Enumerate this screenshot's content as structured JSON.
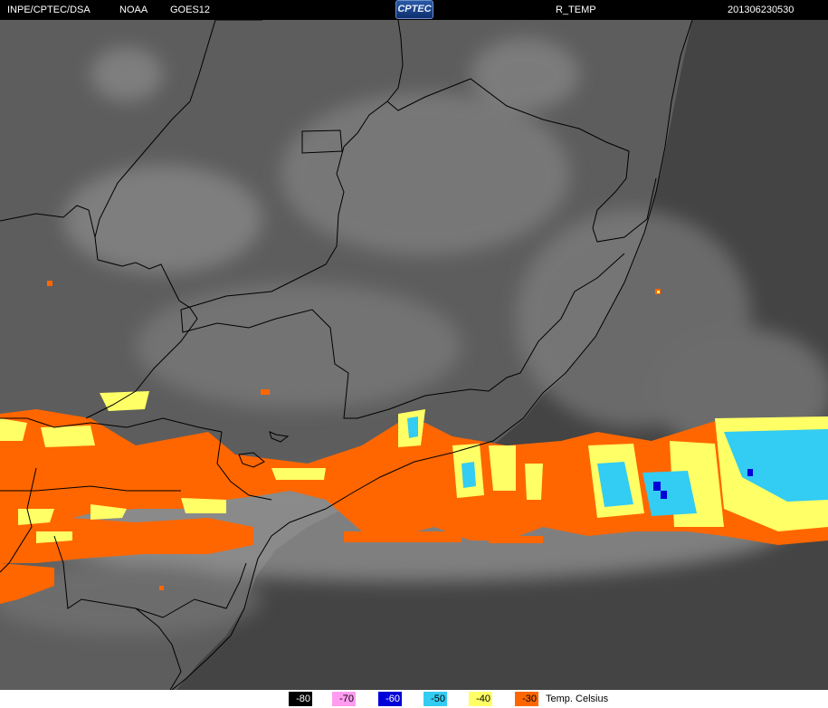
{
  "header": {
    "source": "INPE/CPTEC/DSA",
    "agency": "NOAA",
    "satellite": "GOES12",
    "logo_text": "CPTEC",
    "product": "R_TEMP",
    "timestamp": "201306230530"
  },
  "legend": {
    "items": [
      {
        "label": "-80",
        "color": "#000000",
        "text_color": "#ffffff"
      },
      {
        "label": "-70",
        "color": "#ff9cf0",
        "text_color": "#000000"
      },
      {
        "label": "-60",
        "color": "#0000d8",
        "text_color": "#ffffff"
      },
      {
        "label": "-50",
        "color": "#33ccf2",
        "text_color": "#000000"
      },
      {
        "label": "-40",
        "color": "#ffff66",
        "text_color": "#000000"
      },
      {
        "label": "-30",
        "color": "#ff6600",
        "text_color": "#000000"
      }
    ],
    "caption": "Temp. Celsius"
  },
  "map": {
    "land_color": "#5c5c5c",
    "ocean_color": "#444444",
    "border_color": "#000000"
  }
}
